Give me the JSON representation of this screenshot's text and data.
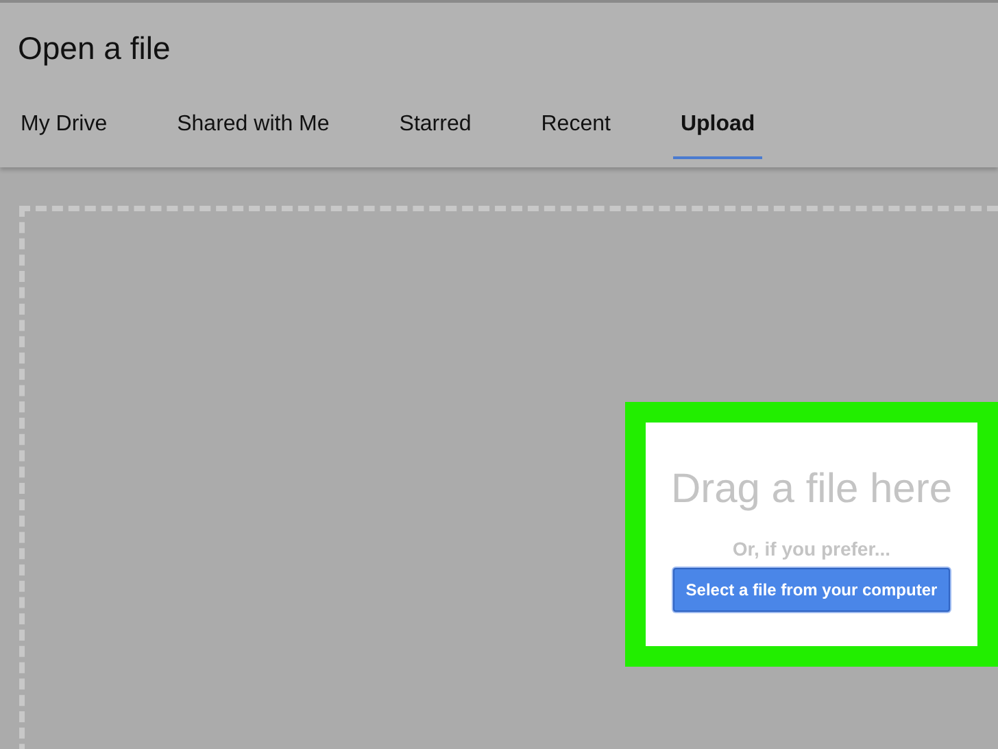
{
  "window": {
    "title": "Open a file"
  },
  "tabs": [
    {
      "label": "My Drive",
      "selected": false
    },
    {
      "label": "Shared with Me",
      "selected": false
    },
    {
      "label": "Starred",
      "selected": false
    },
    {
      "label": "Recent",
      "selected": false
    },
    {
      "label": "Upload",
      "selected": true
    }
  ],
  "upload_panel": {
    "heading": "Drag a file here",
    "subtext": "Or, if you prefer...",
    "button": "Select a file from your computer"
  }
}
